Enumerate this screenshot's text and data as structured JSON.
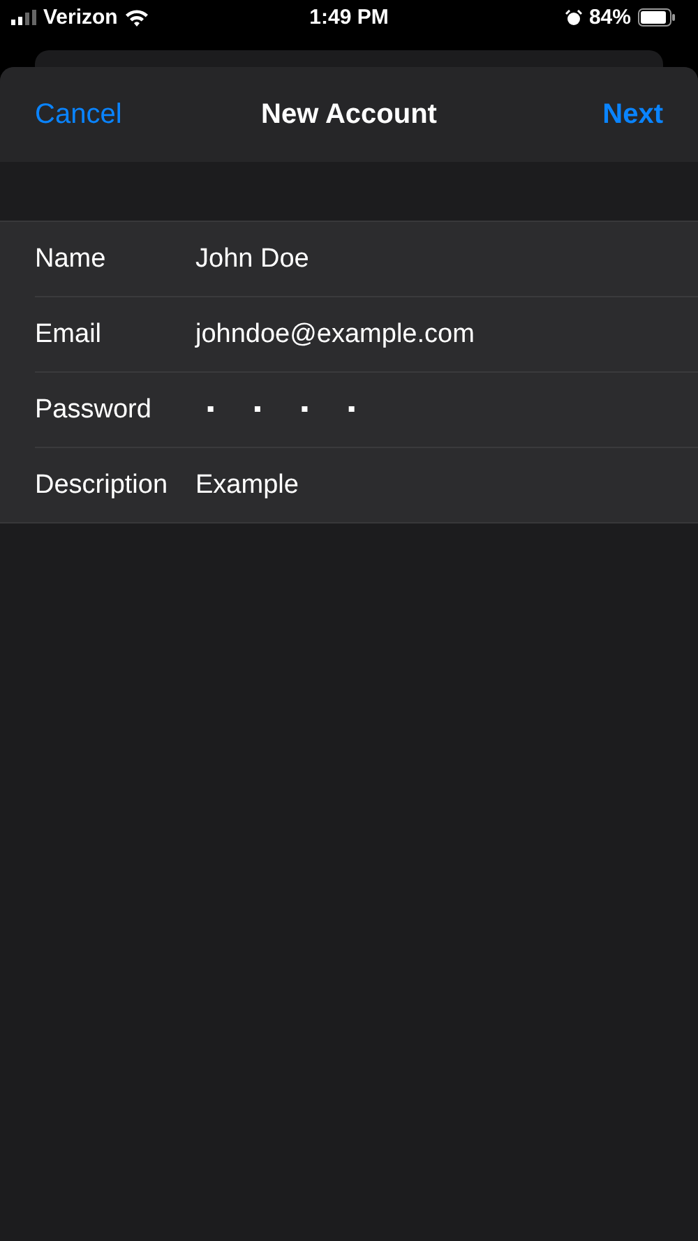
{
  "status_bar": {
    "carrier": "Verizon",
    "time": "1:49 PM",
    "battery": "84%"
  },
  "nav_bar": {
    "cancel": "Cancel",
    "title": "New Account",
    "next": "Next"
  },
  "fields": [
    {
      "kind": "text",
      "label": "Name",
      "value": "John Doe"
    },
    {
      "kind": "text",
      "label": "Email",
      "value": "johndoe@example.com"
    },
    {
      "kind": "password",
      "label": "Password",
      "value": "▪▪▪▪"
    },
    {
      "kind": "text",
      "label": "Description",
      "value": "Example"
    }
  ]
}
